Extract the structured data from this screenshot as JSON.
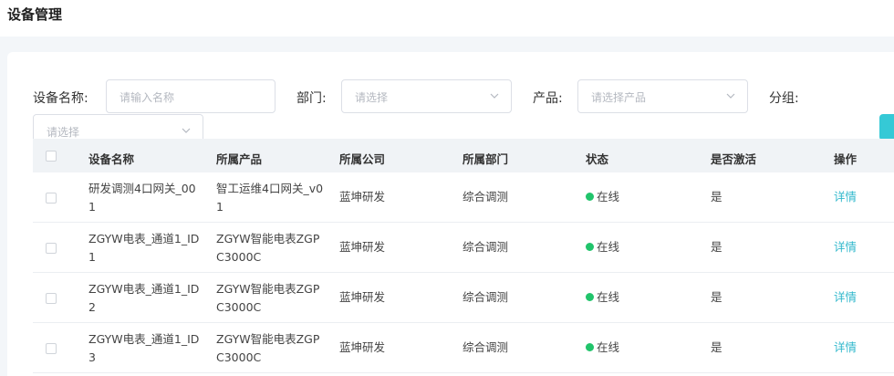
{
  "page": {
    "title": "设备管理"
  },
  "filters": {
    "name_label": "设备名称:",
    "name_placeholder": "请输入名称",
    "dept_label": "部门:",
    "dept_placeholder": "请选择",
    "product_label": "产品:",
    "product_placeholder": "请选择产品",
    "group_label": "分组:",
    "group_placeholder": "请选择"
  },
  "colors": {
    "accent": "#35c9d6",
    "link": "#31b8cc",
    "online": "#21c46b"
  },
  "table": {
    "columns": [
      "设备名称",
      "所属产品",
      "所属公司",
      "所属部门",
      "状态",
      "是否激活",
      "操作"
    ],
    "rows": [
      {
        "name": "研发调测4口网关_001",
        "product": "智工运维4口网关_v01",
        "company": "蓝坤研发",
        "dept": "综合调测",
        "status": "在线",
        "activated": "是",
        "action": "详情"
      },
      {
        "name": "ZGYW电表_通道1_ID1",
        "product": "ZGYW智能电表ZGPC3000C",
        "company": "蓝坤研发",
        "dept": "综合调测",
        "status": "在线",
        "activated": "是",
        "action": "详情"
      },
      {
        "name": "ZGYW电表_通道1_ID2",
        "product": "ZGYW智能电表ZGPC3000C",
        "company": "蓝坤研发",
        "dept": "综合调测",
        "status": "在线",
        "activated": "是",
        "action": "详情"
      },
      {
        "name": "ZGYW电表_通道1_ID3",
        "product": "ZGYW智能电表ZGPC3000C",
        "company": "蓝坤研发",
        "dept": "综合调测",
        "status": "在线",
        "activated": "是",
        "action": "详情"
      }
    ]
  }
}
